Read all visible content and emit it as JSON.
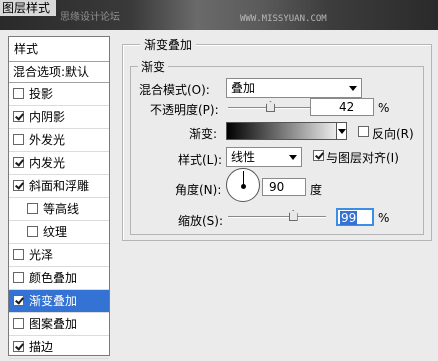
{
  "window": {
    "title": "图层样式",
    "watermark_left": "思缘设计论坛",
    "watermark_right": "WWW.MISSYUAN.COM"
  },
  "sidebar": {
    "header": "样式",
    "blend_options": "混合选项:默认",
    "items": [
      {
        "label": "投影",
        "checked": false,
        "sub": false,
        "selected": false
      },
      {
        "label": "内阴影",
        "checked": true,
        "sub": false,
        "selected": false
      },
      {
        "label": "外发光",
        "checked": false,
        "sub": false,
        "selected": false
      },
      {
        "label": "内发光",
        "checked": true,
        "sub": false,
        "selected": false
      },
      {
        "label": "斜面和浮雕",
        "checked": true,
        "sub": false,
        "selected": false
      },
      {
        "label": "等高线",
        "checked": false,
        "sub": true,
        "selected": false
      },
      {
        "label": "纹理",
        "checked": false,
        "sub": true,
        "selected": false
      },
      {
        "label": "光泽",
        "checked": false,
        "sub": false,
        "selected": false
      },
      {
        "label": "颜色叠加",
        "checked": false,
        "sub": false,
        "selected": false
      },
      {
        "label": "渐变叠加",
        "checked": true,
        "sub": false,
        "selected": true
      },
      {
        "label": "图案叠加",
        "checked": false,
        "sub": false,
        "selected": false
      },
      {
        "label": "描边",
        "checked": true,
        "sub": false,
        "selected": false
      }
    ]
  },
  "panel": {
    "group_title": "渐变叠加",
    "inner_title": "渐变",
    "blend_mode_label": "混合模式(O):",
    "blend_mode_value": "叠加",
    "opacity_label": "不透明度(P):",
    "opacity_value": "42",
    "opacity_unit": "%",
    "opacity_fraction": 0.42,
    "gradient_label": "渐变:",
    "reverse_label": "反向(R)",
    "reverse_checked": false,
    "style_label": "样式(L):",
    "style_value": "线性",
    "align_label": "与图层对齐(I)",
    "align_checked": true,
    "angle_label": "角度(N):",
    "angle_value": "90",
    "angle_unit": "度",
    "scale_label": "缩放(S):",
    "scale_value": "99",
    "scale_unit": "%",
    "scale_fraction": 0.66
  },
  "colors": {
    "selection": "#3472d4",
    "focus_border": "#3a8ee6"
  }
}
